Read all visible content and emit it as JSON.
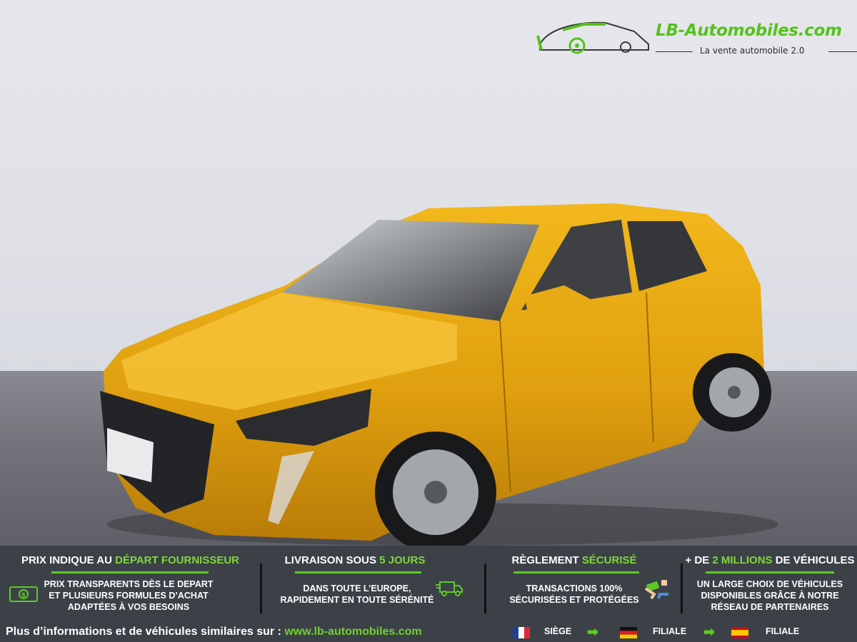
{
  "brand": {
    "name": "LB-Automobiles.com",
    "tagline": "La vente automobile 2.0",
    "accent": "#5ccc22"
  },
  "vehicle": {
    "color": "#e6a512"
  },
  "banner": {
    "background": "#3c4148",
    "features": [
      {
        "title_plain": "PRIX INDIQUE AU ",
        "title_hl": "DÉPART FOURNISSEUR",
        "lines": [
          "PRIX TRANSPARENTS DÈS LE DEPART",
          "ET PLUSIEURS FORMULES D’ACHAT",
          "ADAPTÉES À VOS BESOINS"
        ],
        "icon": "cash-icon"
      },
      {
        "title_plain": "LIVRAISON SOUS ",
        "title_hl": "5 JOURS",
        "lines": [
          "DANS TOUTE L’EUROPE,",
          "RAPIDEMENT EN TOUTE SÉRÉNITÉ"
        ],
        "icon": "delivery-truck-icon"
      },
      {
        "title_plain": "RÈGLEMENT ",
        "title_hl": "SÉCURISÉ",
        "lines": [
          "TRANSACTIONS 100%",
          "SÉCURISÉES ET PROTÉGÉES"
        ],
        "icon": "payment-hands-icon"
      },
      {
        "title_plain": "+ DE ",
        "title_hl": "2 MILLIONS",
        "title_end": " DE VÉHICULES",
        "lines": [
          "UN LARGE CHOIX DE VÉHICULES",
          "DISPONIBLES GRÂCE À NOTRE",
          "RÉSEAU DE PARTENAIRES"
        ]
      }
    ],
    "footer": {
      "text": "Plus d’informations et de véhicules similaires sur : ",
      "link": "www.lb-automobiles.com",
      "locations": [
        {
          "flag": "france-flag-icon",
          "label": "SIÈGE"
        },
        {
          "flag": "germany-flag-icon",
          "label": "FILIALE"
        },
        {
          "flag": "spain-flag-icon",
          "label": "FILIALE"
        }
      ]
    }
  }
}
